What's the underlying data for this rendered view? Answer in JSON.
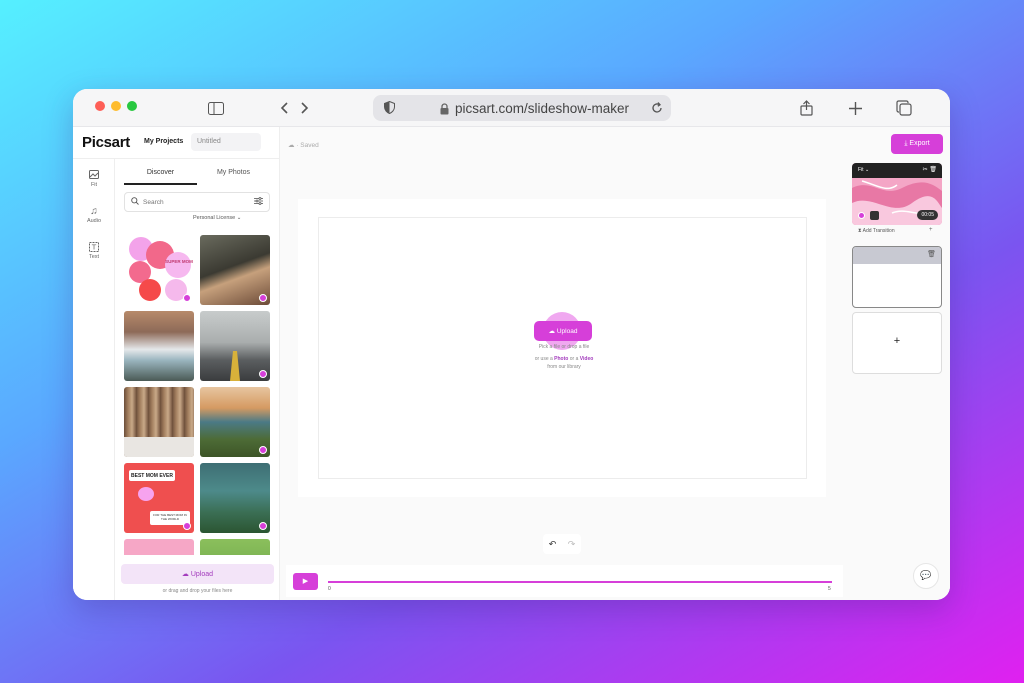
{
  "browser": {
    "url": "picsart.com/slideshow-maker"
  },
  "header": {
    "logo": "Picsart",
    "my_projects": "My Projects",
    "project_name": "Untitled",
    "saved_status": "Saved",
    "export_label": "Export"
  },
  "rail": {
    "items": [
      {
        "label": "Fit",
        "icon": "image-icon"
      },
      {
        "label": "Audio",
        "icon": "music-icon"
      },
      {
        "label": "Text",
        "icon": "text-icon"
      }
    ]
  },
  "sidebar": {
    "tabs": [
      "Discover",
      "My Photos"
    ],
    "search_placeholder": "Search",
    "license_label": "Personal License",
    "thumbnails": [
      {
        "name": "super-mom-graphic",
        "sticker": "SUPER MOM"
      },
      {
        "name": "people-at-laptop"
      },
      {
        "name": "waterfall"
      },
      {
        "name": "foggy-road"
      },
      {
        "name": "blurry-forest"
      },
      {
        "name": "coastal-sunset"
      },
      {
        "name": "best-mom-ever-card",
        "title": "BEST MOM EVER",
        "caption": "FOR THE BEST MOM IN THE WORLD"
      },
      {
        "name": "turquoise-lake"
      },
      {
        "name": "pink-banner"
      },
      {
        "name": "green-foliage"
      }
    ],
    "upload_label": "Upload",
    "drag_hint": "or drag and drop your files here"
  },
  "canvas": {
    "upload_label": "Upload",
    "line1": "Pick a file or drop a file",
    "line2_prefix": "or use a ",
    "photo_link": "Photo",
    "or": " or a ",
    "video_link": "Video",
    "line3": "from our library"
  },
  "timeline": {
    "start": "0",
    "end": "5"
  },
  "slides": {
    "fit_label": "Fit",
    "duration": "00:05",
    "add_transition": "Add Transition",
    "add_slide": "+"
  },
  "colors": {
    "accent": "#d63fd9"
  }
}
